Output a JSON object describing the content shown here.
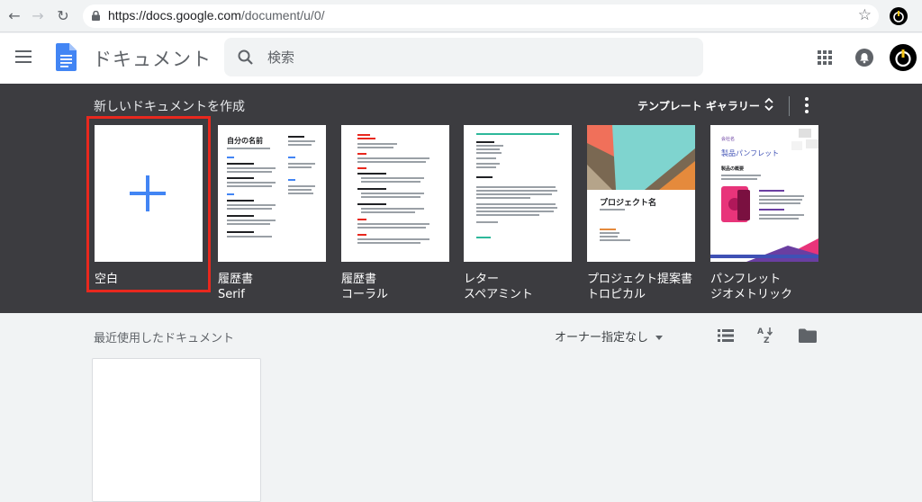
{
  "browser": {
    "url_host": "https://docs.google.com",
    "url_path": "/document/u/0/",
    "back_icon": "arrow-left-icon",
    "forward_icon": "arrow-right-icon",
    "reload_icon": "reload-icon",
    "bookmark_icon": "star-icon"
  },
  "header": {
    "app_title": "ドキュメント",
    "search_placeholder": "検索"
  },
  "templates": {
    "section_title": "新しいドキュメントを作成",
    "gallery_label": "テンプレート ギャラリー",
    "items": [
      {
        "line1": "空白",
        "line2": ""
      },
      {
        "line1": "履歴書",
        "line2": "Serif"
      },
      {
        "line1": "履歴書",
        "line2": "コーラル"
      },
      {
        "line1": "レター",
        "line2": "スペアミント"
      },
      {
        "line1": "プロジェクト提案書",
        "line2": "トロピカル"
      },
      {
        "line1": "パンフレット",
        "line2": "ジオメトリック"
      }
    ],
    "thumbs": {
      "resume_name": "自分の名前",
      "project_title": "プロジェクト名",
      "brochure_small": "会社名",
      "brochure_title": "製品パンフレット",
      "brochure_sub": "製品の概要"
    }
  },
  "recent": {
    "title": "最近使用したドキュメント",
    "owner_filter": "オーナー指定なし"
  },
  "colors": {
    "accent_blue": "#4285f4",
    "highlight_red": "#e8281e",
    "dark_band": "#3c3c40"
  }
}
